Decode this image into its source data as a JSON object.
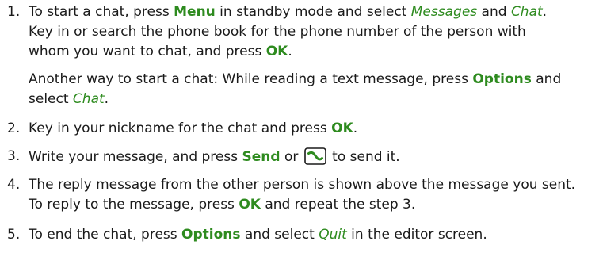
{
  "steps": [
    {
      "number": "1.",
      "lines": [
        [
          "To start a chat, press ",
          "Menu",
          " in standby mode and select ",
          "Messages",
          " and ",
          "Chat",
          "."
        ],
        [
          "Key in or search the phone book for the phone number of the person with"
        ],
        [
          "whom you want to chat, and press ",
          "OK",
          "."
        ],
        [
          "Another way to start a chat: While reading a text message, press ",
          "Options",
          " and"
        ],
        [
          "select ",
          "Chat",
          "."
        ]
      ]
    },
    {
      "number": "2.",
      "lines": [
        [
          "Key in your nickname for the chat and press ",
          "OK",
          "."
        ]
      ]
    },
    {
      "number": "3.",
      "lines": [
        [
          "Write your message, and press ",
          "Send",
          " or ",
          " to send it."
        ]
      ]
    },
    {
      "number": "4.",
      "lines": [
        [
          "The reply message from the other person is shown above the message you sent."
        ],
        [
          "To reply to the message, press ",
          "OK",
          " and repeat the step 3."
        ]
      ]
    },
    {
      "number": "5.",
      "lines": [
        [
          "To end the chat, press ",
          "Options",
          " and select ",
          "Quit",
          " in the editor screen."
        ]
      ]
    }
  ],
  "icons": {
    "call_key": "call-key-icon"
  },
  "colors": {
    "key_text": "#2e8b1f",
    "body_text": "#1a1a1a"
  }
}
